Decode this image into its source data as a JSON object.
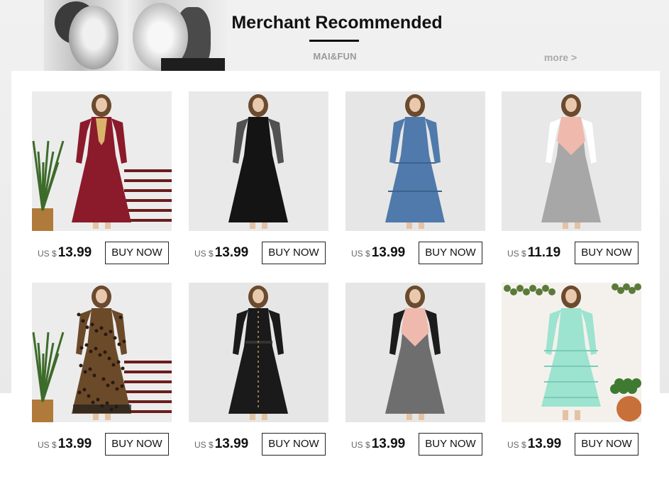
{
  "section": {
    "title": "Merchant Recommended",
    "brand": "MAI&FUN",
    "more_label": "more >"
  },
  "products": [
    {
      "currency": "US $",
      "price": "13.99",
      "button": "BUY NOW",
      "dress_color": "#8b1b2a",
      "bg": "#ececec",
      "style": "burgundy-embroidered"
    },
    {
      "currency": "US $",
      "price": "13.99",
      "button": "BUY NOW",
      "dress_color": "#141414",
      "bg": "#e9e9e9",
      "style": "black-lace-sleeve"
    },
    {
      "currency": "US $",
      "price": "13.99",
      "button": "BUY NOW",
      "dress_color": "#4f7aab",
      "bg": "#e6e6e6",
      "style": "denim-tiered"
    },
    {
      "currency": "US $",
      "price": "11.19",
      "button": "BUY NOW",
      "dress_color": "#a7a7a7",
      "bg": "#e8e8e8",
      "style": "pink-grey-colorblock"
    },
    {
      "currency": "US $",
      "price": "13.99",
      "button": "BUY NOW",
      "dress_color": "#6b4a2a",
      "bg": "#ececec",
      "style": "leopard-print"
    },
    {
      "currency": "US $",
      "price": "13.99",
      "button": "BUY NOW",
      "dress_color": "#1a1a1a",
      "bg": "#e6e6e6",
      "style": "black-belted"
    },
    {
      "currency": "US $",
      "price": "13.99",
      "button": "BUY NOW",
      "dress_color": "#6e6e6e",
      "bg": "#e6e6e6",
      "style": "pink-black-grey-colorblock"
    },
    {
      "currency": "US $",
      "price": "13.99",
      "button": "BUY NOW",
      "dress_color": "#9ce3d0",
      "bg": "#f4f1ec",
      "style": "mint-ruffle"
    }
  ]
}
